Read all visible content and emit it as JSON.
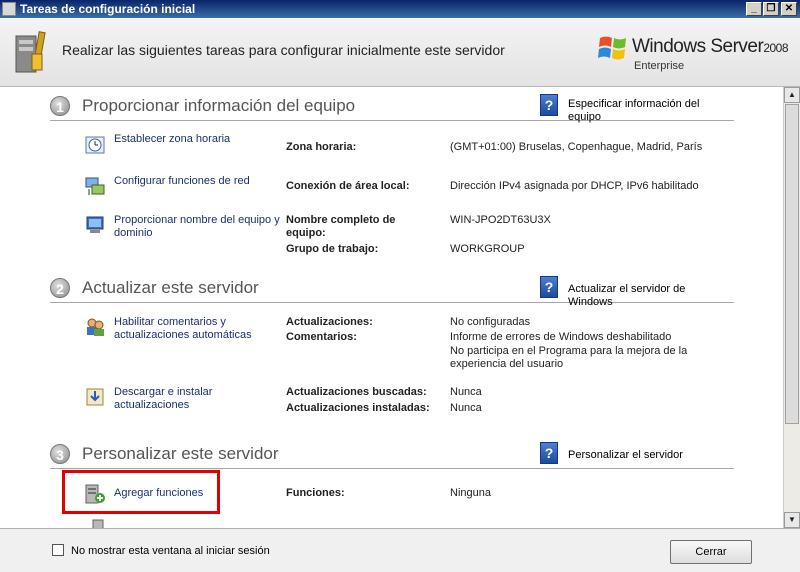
{
  "window": {
    "title": "Tareas de configuración inicial",
    "controls": {
      "minimize": "_",
      "restore": "❐",
      "close": "✕"
    }
  },
  "header": {
    "text": "Realizar las siguientes tareas para configurar inicialmente este servidor",
    "brand_name": "Windows Server",
    "brand_version": "2008",
    "brand_edition": "Enterprise"
  },
  "sections": [
    {
      "number": "1",
      "title": "Proporcionar información del equipo",
      "link": "Especificar información del equipo",
      "tasks": [
        {
          "label": "Establecer zona horaria",
          "fields": [
            {
              "label": "Zona horaria:",
              "value": "(GMT+01:00) Bruselas, Copenhague, Madrid, París"
            }
          ]
        },
        {
          "label": "Configurar funciones de red",
          "fields": [
            {
              "label": "Conexión de área local:",
              "value": "Dirección IPv4 asignada por DHCP, IPv6 habilitado"
            }
          ]
        },
        {
          "label": "Proporcionar nombre del equipo y dominio",
          "fields": [
            {
              "label": "Nombre completo de equipo:",
              "value": "WIN-JPO2DT63U3X"
            },
            {
              "label": "Grupo de trabajo:",
              "value": "WORKGROUP"
            }
          ]
        }
      ]
    },
    {
      "number": "2",
      "title": "Actualizar este servidor",
      "link": "Actualizar el servidor de Windows",
      "tasks": [
        {
          "label": "Habilitar comentarios y actualizaciones automáticas",
          "fields": [
            {
              "label": "Actualizaciones:",
              "value": "No configuradas"
            },
            {
              "label": "Comentarios:",
              "value": "Informe de errores de Windows deshabilitado"
            }
          ],
          "extra": "No participa en el Programa para la mejora de la experiencia del usuario"
        },
        {
          "label": "Descargar e instalar actualizaciones",
          "fields": [
            {
              "label": "Actualizaciones buscadas:",
              "value": "Nunca"
            },
            {
              "label": "Actualizaciones instaladas:",
              "value": "Nunca"
            }
          ]
        }
      ]
    },
    {
      "number": "3",
      "title": "Personalizar este servidor",
      "link": "Personalizar el servidor",
      "tasks": [
        {
          "label": "Agregar funciones",
          "fields": [
            {
              "label": "Funciones:",
              "value": "Ninguna"
            }
          ]
        }
      ]
    }
  ],
  "footer": {
    "checkbox_label": "No mostrar esta ventana al iniciar sesión",
    "close_button": "Cerrar"
  },
  "icons": [
    "tools-icon",
    "windows-flag-icon",
    "help-icon",
    "clock-icon",
    "network-icon",
    "computer-icon",
    "users-icon",
    "download-icon",
    "server-add-icon"
  ],
  "colors": {
    "title_bar": "#0a246a",
    "link": "#1a2f6e",
    "highlight": "#e00000",
    "section_title": "#555555"
  }
}
